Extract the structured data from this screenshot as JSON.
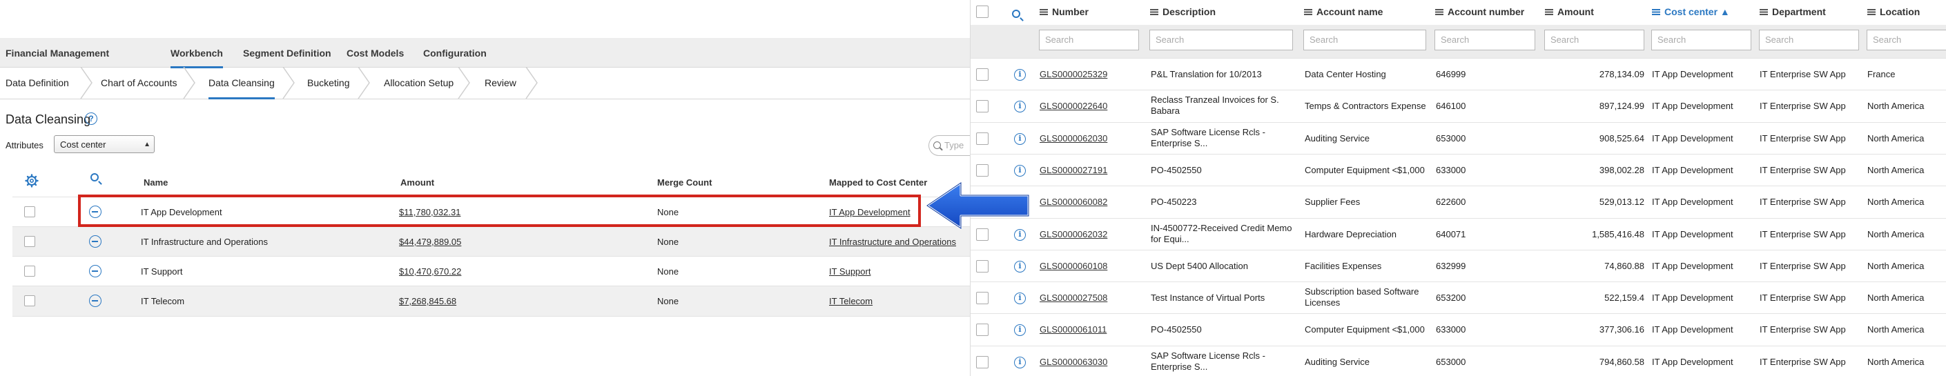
{
  "app": {
    "title": "Financial Management",
    "nav": [
      "Workbench",
      "Segment Definition",
      "Cost Models",
      "Configuration"
    ],
    "active_nav": 0
  },
  "steps": [
    "Data Definition",
    "Chart of Accounts",
    "Data Cleansing",
    "Bucketing",
    "Allocation Setup",
    "Review"
  ],
  "active_step": 2,
  "page": {
    "title": "Data Cleansing",
    "help": "?",
    "attributes_label": "Attributes",
    "attributes_value": "Cost center",
    "search_placeholder": "Type"
  },
  "left_table": {
    "headers": {
      "name": "Name",
      "amount": "Amount",
      "merge_count": "Merge Count",
      "mapped": "Mapped to Cost Center"
    },
    "rows": [
      {
        "name": "IT App Development",
        "amount": "$11,780,032.31",
        "merge": "None",
        "mapped": "IT App Development"
      },
      {
        "name": "IT Infrastructure and Operations",
        "amount": "$44,479,889.05",
        "merge": "None",
        "mapped": "IT Infrastructure and Operations"
      },
      {
        "name": "IT Support",
        "amount": "$10,470,670.22",
        "merge": "None",
        "mapped": "IT Support"
      },
      {
        "name": "IT Telecom",
        "amount": "$7,268,845.68",
        "merge": "None",
        "mapped": "IT Telecom"
      }
    ]
  },
  "right_table": {
    "headers": {
      "number": "Number",
      "description": "Description",
      "account_name": "Account name",
      "account_number": "Account number",
      "amount": "Amount",
      "cost_center": "Cost center ▲",
      "department": "Department",
      "location": "Location"
    },
    "search_placeholder": "Search",
    "rows": [
      {
        "number": "GLS0000025329",
        "description": "P&L Translation for 10/2013",
        "account_name": "Data Center Hosting",
        "account_number": "646999",
        "amount": "278,134.09",
        "cost_center": "IT App Development",
        "department": "IT Enterprise SW App",
        "location": "France"
      },
      {
        "number": "GLS0000022640",
        "description": "Reclass Tranzeal Invoices for S. Babara",
        "account_name": "Temps & Contractors Expense",
        "account_number": "646100",
        "amount": "897,124.99",
        "cost_center": "IT App Development",
        "department": "IT Enterprise SW App",
        "location": "North America"
      },
      {
        "number": "GLS0000062030",
        "description": "SAP Software License Rcls - Enterprise S...",
        "account_name": "Auditing Service",
        "account_number": "653000",
        "amount": "908,525.64",
        "cost_center": "IT App Development",
        "department": "IT Enterprise SW App",
        "location": "North America"
      },
      {
        "number": "GLS0000027191",
        "description": "PO-4502550",
        "account_name": "Computer Equipment <$1,000",
        "account_number": "633000",
        "amount": "398,002.28",
        "cost_center": "IT App Development",
        "department": "IT Enterprise SW App",
        "location": "North America"
      },
      {
        "number": "GLS0000060082",
        "description": "PO-450223",
        "account_name": "Supplier Fees",
        "account_number": "622600",
        "amount": "529,013.12",
        "cost_center": "IT App Development",
        "department": "IT Enterprise SW App",
        "location": "North America"
      },
      {
        "number": "GLS0000062032",
        "description": "IN-4500772-Received Credit Memo for Equi...",
        "account_name": "Hardware Depreciation",
        "account_number": "640071",
        "amount": "1,585,416.48",
        "cost_center": "IT App Development",
        "department": "IT Enterprise SW App",
        "location": "North America"
      },
      {
        "number": "GLS0000060108",
        "description": "US Dept 5400 Allocation",
        "account_name": "Facilities Expenses",
        "account_number": "632999",
        "amount": "74,860.88",
        "cost_center": "IT App Development",
        "department": "IT Enterprise SW App",
        "location": "North America"
      },
      {
        "number": "GLS0000027508",
        "description": "Test Instance of Virtual Ports",
        "account_name": "Subscription based Software Licenses",
        "account_number": "653200",
        "amount": "522,159.4",
        "cost_center": "IT App Development",
        "department": "IT Enterprise SW App",
        "location": "North America"
      },
      {
        "number": "GLS0000061011",
        "description": "PO-4502550",
        "account_name": "Computer Equipment <$1,000",
        "account_number": "633000",
        "amount": "377,306.16",
        "cost_center": "IT App Development",
        "department": "IT Enterprise SW App",
        "location": "North America"
      },
      {
        "number": "GLS0000063030",
        "description": "SAP Software License Rcls - Enterprise S...",
        "account_name": "Auditing Service",
        "account_number": "653000",
        "amount": "794,860.58",
        "cost_center": "IT App Development",
        "department": "IT Enterprise SW App",
        "location": "North America"
      }
    ]
  },
  "colors": {
    "accent": "#2b78c2",
    "highlight": "#d2251d",
    "arrow": "#1f5fd6"
  }
}
